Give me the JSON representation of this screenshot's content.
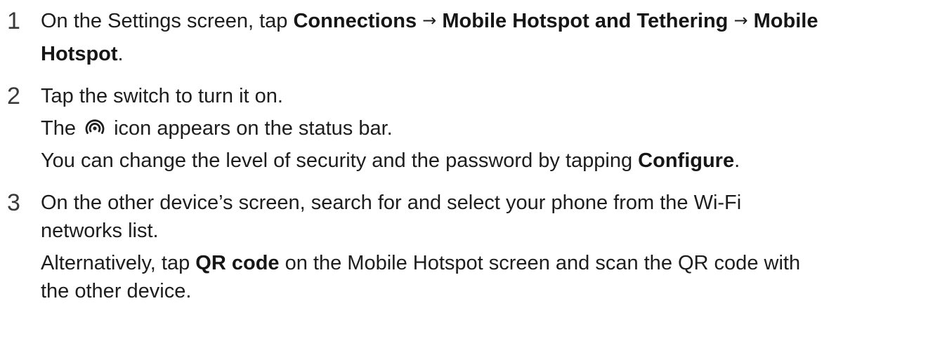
{
  "steps": [
    {
      "number": "1",
      "intro": "On the Settings screen, tap ",
      "path_1": "Connections",
      "arrow_1": "→",
      "path_2": "Mobile Hotspot and Tethering",
      "arrow_2": "→",
      "path_3a": "Mobile",
      "path_3b": "Hotspot",
      "end": "."
    },
    {
      "number": "2",
      "line1": "Tap the switch to turn it on.",
      "line2_before": "The ",
      "icon": "mobile-hotspot-icon",
      "line2_after": " icon appears on the status bar.",
      "line3_before": "You can change the level of security and the password by tapping ",
      "line3_bold": "Configure",
      "line3_end": "."
    },
    {
      "number": "3",
      "line1a": "On the other device’s screen, search for and select your phone from the Wi-Fi",
      "line1b": "networks list.",
      "line2_before": "Alternatively, tap ",
      "line2_bold": "QR code",
      "line2_after": " on the Mobile Hotspot screen and scan the QR code with",
      "line2b": "the other device."
    }
  ]
}
